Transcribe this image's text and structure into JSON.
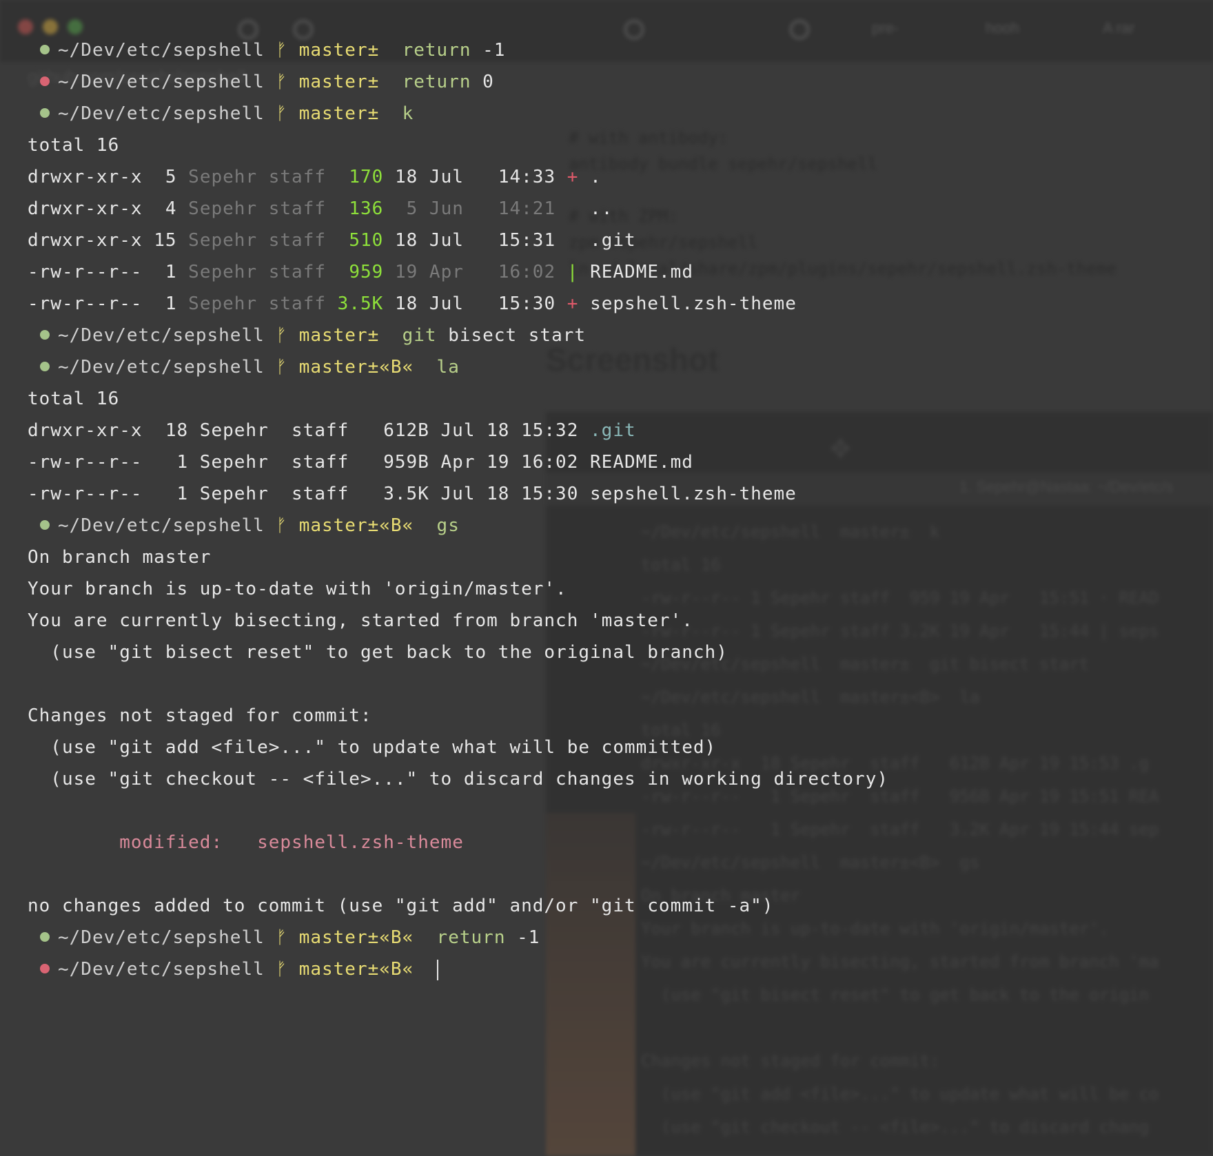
{
  "prompt": {
    "path": "~/Dev/etc/sepshell",
    "branch_glyph": "ᚠ",
    "branch_plain": "master±",
    "branch_bisect": "master±«B«"
  },
  "lines": [
    {
      "type": "prompt",
      "status": "ok",
      "branch": "master±",
      "cmd": "return",
      "arg": "-1"
    },
    {
      "type": "prompt",
      "status": "err",
      "branch": "master±",
      "cmd": "return",
      "arg": "0"
    },
    {
      "type": "prompt",
      "status": "ok",
      "branch": "master±",
      "cmd": "k",
      "arg": ""
    },
    {
      "type": "text",
      "text": "total 16"
    },
    {
      "type": "ls",
      "perm": "drwxr-xr-x",
      "links": " 5",
      "owner": "Sepehr staff",
      "size": " 170",
      "date": "18 Jul",
      "time": "14:33",
      "mark": "+",
      "name": ".",
      "dim_date": false
    },
    {
      "type": "ls",
      "perm": "drwxr-xr-x",
      "links": " 4",
      "owner": "Sepehr staff",
      "size": " 136",
      "date": " 5 Jun",
      "time": "14:21",
      "mark": " ",
      "name": "..",
      "dim_date": true
    },
    {
      "type": "ls",
      "perm": "drwxr-xr-x",
      "links": "15",
      "owner": "Sepehr staff",
      "size": " 510",
      "date": "18 Jul",
      "time": "15:31",
      "mark": " ",
      "name": ".git",
      "dim_date": false
    },
    {
      "type": "ls",
      "perm": "-rw-r--r--",
      "links": " 1",
      "owner": "Sepehr staff",
      "size": " 959",
      "date": "19 Apr",
      "time": "16:02",
      "mark": "|",
      "name": "README.md",
      "dim_date": true
    },
    {
      "type": "ls",
      "perm": "-rw-r--r--",
      "links": " 1",
      "owner": "Sepehr staff",
      "size": "3.5K",
      "date": "18 Jul",
      "time": "15:30",
      "mark": "+",
      "name": "sepshell.zsh-theme",
      "dim_date": false
    },
    {
      "type": "prompt",
      "status": "ok",
      "branch": "master±",
      "cmd": "git",
      "arg": "bisect start"
    },
    {
      "type": "prompt",
      "status": "ok",
      "branch": "master±«B«",
      "cmd": "la",
      "arg": ""
    },
    {
      "type": "text",
      "text": "total 16"
    },
    {
      "type": "la",
      "left": "drwxr-xr-x  18 Sepehr  staff   612B Jul 18 15:32 ",
      "name": ".git",
      "git": true
    },
    {
      "type": "la",
      "left": "-rw-r--r--   1 Sepehr  staff   959B Apr 19 16:02 ",
      "name": "README.md",
      "git": false
    },
    {
      "type": "la",
      "left": "-rw-r--r--   1 Sepehr  staff   3.5K Jul 18 15:30 ",
      "name": "sepshell.zsh-theme",
      "git": false
    },
    {
      "type": "prompt",
      "status": "ok",
      "branch": "master±«B«",
      "cmd": "gs",
      "arg": ""
    },
    {
      "type": "text",
      "text": "On branch master"
    },
    {
      "type": "text",
      "text": "Your branch is up-to-date with 'origin/master'."
    },
    {
      "type": "text",
      "text": "You are currently bisecting, started from branch 'master'."
    },
    {
      "type": "text",
      "text": "  (use \"git bisect reset\" to get back to the original branch)"
    },
    {
      "type": "blank"
    },
    {
      "type": "text",
      "text": "Changes not staged for commit:"
    },
    {
      "type": "text",
      "text": "  (use \"git add <file>...\" to update what will be committed)"
    },
    {
      "type": "text",
      "text": "  (use \"git checkout -- <file>...\" to discard changes in working directory)"
    },
    {
      "type": "blank"
    },
    {
      "type": "mod",
      "label": "modified:",
      "file": "sepshell.zsh-theme"
    },
    {
      "type": "blank"
    },
    {
      "type": "text",
      "text": "no changes added to commit (use \"git add\" and/or \"git commit -a\")"
    },
    {
      "type": "prompt",
      "status": "ok",
      "branch": "master±«B«",
      "cmd": "return",
      "arg": "-1"
    },
    {
      "type": "prompt",
      "status": "err",
      "branch": "master±«B«",
      "cmd": "",
      "arg": "",
      "cursor": true
    }
  ],
  "background": {
    "tabs": [
      "pre-",
      "hooh",
      "A rar"
    ],
    "url": "github.com/sepehr/sepshell",
    "code": [
      "# with antibody:",
      "antibody bundle sepehr/sepshell",
      "",
      "# with ZPM:",
      "zpm sepehr/sepshell",
      "ln ~/.local/share/zpm/plugins/sepehr/sepshell.zsh-theme"
    ],
    "heading": "Screenshot",
    "window_title": "1. Sepehr@Nastaa: ~/Dev/etc/s",
    "shot_lines": [
      "~/Dev/etc/sepshell  master±  k",
      "total 16",
      "-rw-r--r-- 1 Sepehr staff  959 19 Apr   15:51 · READ",
      "-rw-r--r-- 1 Sepehr staff 3.2K 19 Apr   15:44 | seps",
      "~/Dev/etc/sepshell  master±  git bisect start",
      "~/Dev/etc/sepshell  master±<B>  la",
      "total 16",
      "drwxr-xr-x  18 Sepehr  staff   612B Apr 19 15:53 .g",
      "-rw-r--r--   1 Sepehr  staff   956B Apr 19 15:51 REA",
      "-rw-r--r--   1 Sepehr  staff   3.2K Apr 19 15:44 sep",
      "~/Dev/etc/sepshell  master±<B>  gs",
      "On branch master",
      "Your branch is up-to-date with 'origin/master'.",
      "You are currently bisecting, started from branch 'ma",
      "  (use \"git bisect reset\" to get back to the origin",
      "",
      "Changes not staged for commit:",
      "  (use \"git add <file>...\" to update what will be co",
      "  (use \"git checkout -- <file>...\" to discard chang"
    ]
  },
  "colors": {
    "ok_dot": "#a5c38a",
    "err_dot": "#d96473",
    "branch": "#e8dc73",
    "command": "#b8d08a",
    "size": "#8ee03a",
    "modified": "#d98a9a"
  }
}
